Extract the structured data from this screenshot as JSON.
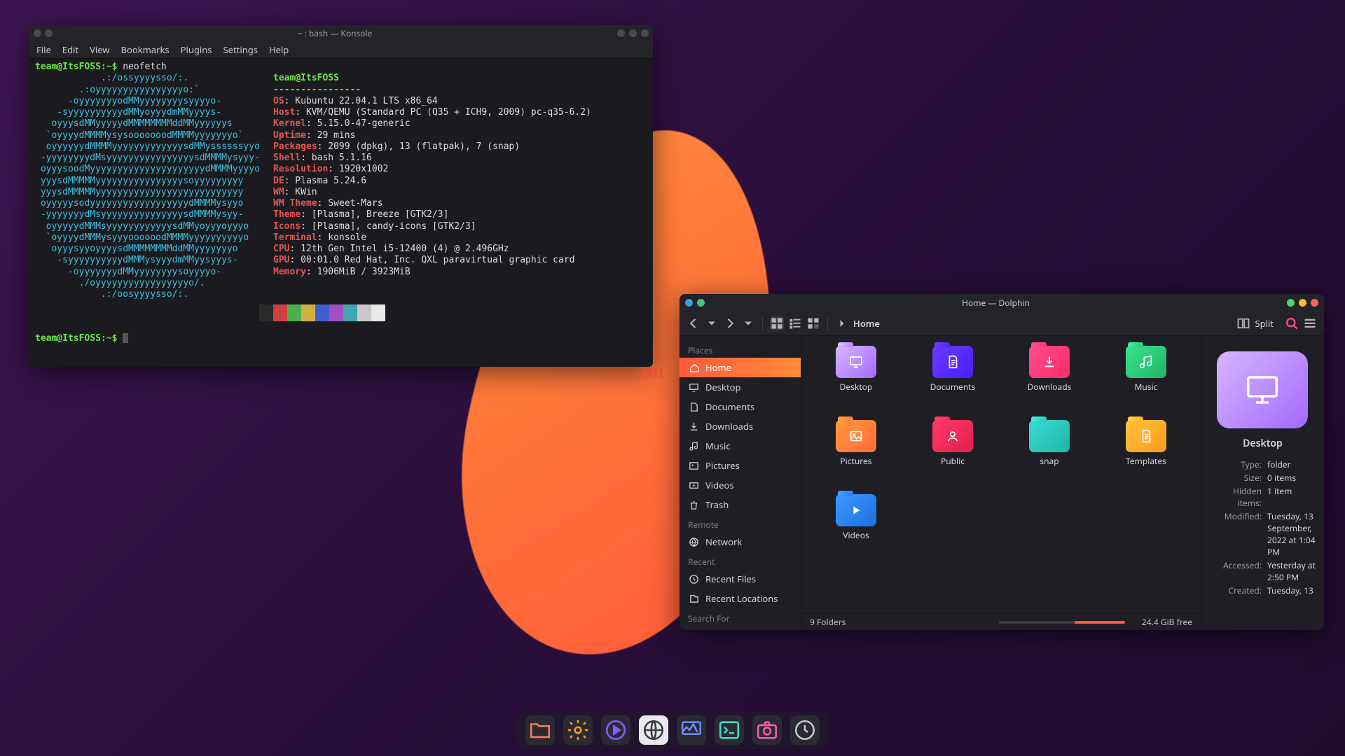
{
  "watermark_text": "j301",
  "konsole": {
    "title": "~ : bash — Konsole",
    "menu": [
      "File",
      "Edit",
      "View",
      "Bookmarks",
      "Plugins",
      "Settings",
      "Help"
    ],
    "prompt": "team@ItsFOSS:~$",
    "command": "neofetch",
    "logo_lines": [
      "            .:/ossyyyysso/:.",
      "        .:oyyyyyyyyyyyyyyyyo:`",
      "      -oyyyyyyyodMMyyyyyyyysyyyyo-",
      "    -syyyyyyyyyydMMyoyyydmMMyyyys-",
      "   oyyysdMMyyyyydMMMMMMMMddMMyyyyyys",
      "  `oyyyydMMMMysysooooooodMMMMyyyyyyyo`",
      "  oyyyyyydMMMMyyyyyyyyyyyyysdMMyssssssyyo",
      " -yyyyyyyydMsyyyyyyyyyyyyyyyysdMMMMysyyy-",
      " oyyysoodMyyyyyyyyyyyyyyyyyyyyydMMMMyyyyo",
      " yyysdMMMMMyyyyyyyyyyyyyyyysoyyyyyyyyy",
      " yyysdMMMMMyyyyyyyyyyyyyyyyyyyyyyyyyyy",
      " oyyyyysodyyyyyyyyyyyyyyyyyydMMMMysyyo",
      " -yyyyyyydMsyyyyyyyyyyyyyyysdMMMMysyy-",
      "  oyyyyydMMMsyyyyyyyyyyyysdMMyoyyyoyyyo",
      "  `oyyyydMMMysyyyoooooodMMMMyyyyyyyyyyo",
      "   oyyysyyoyyyysdMMMMMMMMddMMyyyyyyyo",
      "    -syyyyyyyyyydMMMysyyydmMMyysyyys-",
      "      -oyyyyyyydMMyyyyyyyysoyyyyo-",
      "        ./oyyyyyyyyyyyyyyyyyo/.",
      "            .:/oosyyyysso/:."
    ],
    "info": [
      {
        "label": "team@ItsFOSS",
        "value": ""
      },
      {
        "label": "----------------",
        "value": ""
      },
      {
        "label": "OS",
        "value": "Kubuntu 22.04.1 LTS x86_64"
      },
      {
        "label": "Host",
        "value": "KVM/QEMU (Standard PC (Q35 + ICH9, 2009) pc-q35-6.2)"
      },
      {
        "label": "Kernel",
        "value": "5.15.0-47-generic"
      },
      {
        "label": "Uptime",
        "value": "29 mins"
      },
      {
        "label": "Packages",
        "value": "2099 (dpkg), 13 (flatpak), 7 (snap)"
      },
      {
        "label": "Shell",
        "value": "bash 5.1.16"
      },
      {
        "label": "Resolution",
        "value": "1920x1002"
      },
      {
        "label": "DE",
        "value": "Plasma 5.24.6"
      },
      {
        "label": "WM",
        "value": "KWin"
      },
      {
        "label": "WM Theme",
        "value": "Sweet-Mars"
      },
      {
        "label": "Theme",
        "value": "[Plasma], Breeze [GTK2/3]"
      },
      {
        "label": "Icons",
        "value": "[Plasma], candy-icons [GTK2/3]"
      },
      {
        "label": "Terminal",
        "value": "konsole"
      },
      {
        "label": "CPU",
        "value": "12th Gen Intel i5-12400 (4) @ 2.496GHz"
      },
      {
        "label": "GPU",
        "value": "00:01.0 Red Hat, Inc. QXL paravirtual graphic card"
      },
      {
        "label": "Memory",
        "value": "1906MiB / 3923MiB"
      }
    ],
    "swatches": [
      "#2a2a2a",
      "#d04040",
      "#4cb04c",
      "#d0b040",
      "#4060d0",
      "#a050c0",
      "#40a8b0",
      "#c8c8c8",
      "#e8e8e8"
    ],
    "prompt2": "team@ItsFOSS:~$"
  },
  "dolphin": {
    "title": "Home — Dolphin",
    "tl_dots": [
      "#3aa0e0",
      "#46c27a"
    ],
    "tr_dots": [
      "#4cd964",
      "#ffbd2e",
      "#ff5f56"
    ],
    "crumb": "Home",
    "split_label": "Split",
    "sidebar": {
      "places_heading": "Places",
      "places": [
        "Home",
        "Desktop",
        "Documents",
        "Downloads",
        "Music",
        "Pictures",
        "Videos",
        "Trash"
      ],
      "remote_heading": "Remote",
      "remote": [
        "Network"
      ],
      "recent_heading": "Recent",
      "recent": [
        "Recent Files",
        "Recent Locations"
      ],
      "search_heading": "Search For"
    },
    "folders": [
      {
        "name": "Desktop",
        "color1": "#d8b5ff",
        "color2": "#a06bff",
        "glyph": "monitor"
      },
      {
        "name": "Documents",
        "color1": "#6a3cff",
        "color2": "#4a1cff",
        "glyph": "doc"
      },
      {
        "name": "Downloads",
        "color1": "#ff4d8d",
        "color2": "#ff2a68",
        "glyph": "download"
      },
      {
        "name": "Music",
        "color1": "#3be28c",
        "color2": "#1fb567",
        "glyph": "music"
      },
      {
        "name": "Pictures",
        "color1": "#ff9a3a",
        "color2": "#ff6a3a",
        "glyph": "image"
      },
      {
        "name": "Public",
        "color1": "#ff3a6b",
        "color2": "#e01f4f",
        "glyph": "user"
      },
      {
        "name": "snap",
        "color1": "#3adbd0",
        "color2": "#1fb5ab",
        "glyph": "none"
      },
      {
        "name": "Templates",
        "color1": "#ffc23a",
        "color2": "#ff9a1f",
        "glyph": "doc"
      },
      {
        "name": "Videos",
        "color1": "#3a9bff",
        "color2": "#1f6fe0",
        "glyph": "play"
      }
    ],
    "status": {
      "count": "9 Folders",
      "free": "24.4 GiB free"
    },
    "info": {
      "name": "Desktop",
      "rows": [
        {
          "k": "Type:",
          "v": "folder"
        },
        {
          "k": "Size:",
          "v": "0 items"
        },
        {
          "k": "Hidden items:",
          "v": "1 item"
        },
        {
          "k": "Modified:",
          "v": "Tuesday, 13 September, 2022 at 1:04 PM"
        },
        {
          "k": "Accessed:",
          "v": "Yesterday at 2:50 PM"
        },
        {
          "k": "Created:",
          "v": "Tuesday, 13"
        }
      ]
    }
  },
  "dock": [
    {
      "name": "files",
      "bg": "#2a2a32",
      "color": "#ff7d4a"
    },
    {
      "name": "settings",
      "bg": "#2a2a32",
      "color": "#ff9a1f"
    },
    {
      "name": "media",
      "bg": "#2a2a32",
      "color": "#8a5cff"
    },
    {
      "name": "browser",
      "bg": "#e8e8ee",
      "color": "#3a3a42"
    },
    {
      "name": "monitor",
      "bg": "#2a2a32",
      "color": "#6a8aff"
    },
    {
      "name": "terminal",
      "bg": "#2a2a32",
      "color": "#3adbd0"
    },
    {
      "name": "screenshot",
      "bg": "#2a2a32",
      "color": "#ff5aa5"
    },
    {
      "name": "clock",
      "bg": "#2a2a32",
      "color": "#c8c8ce"
    }
  ]
}
